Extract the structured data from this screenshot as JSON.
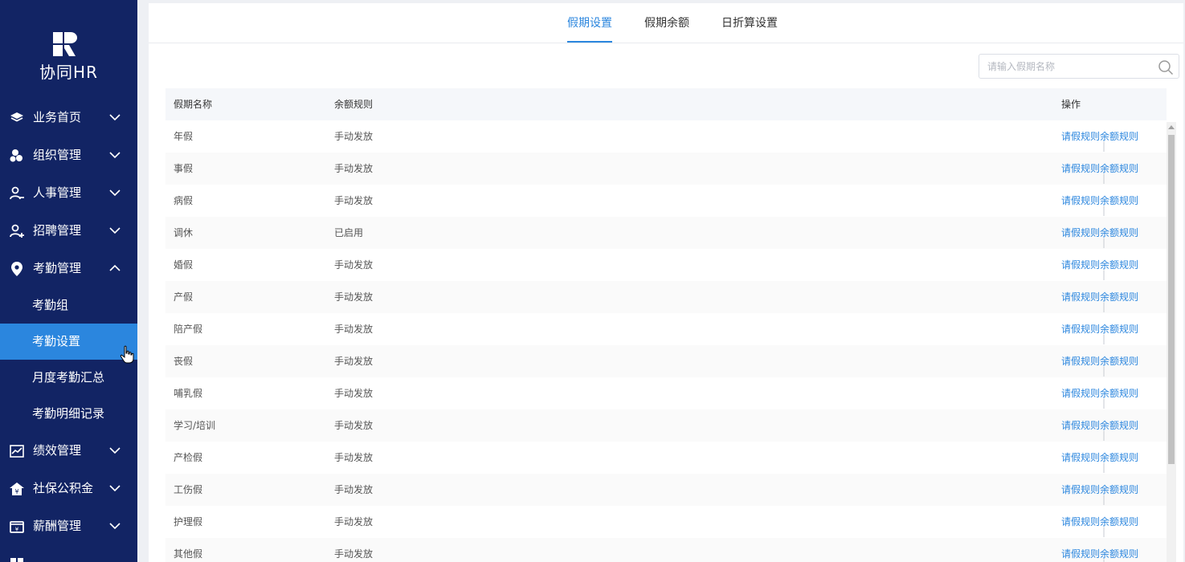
{
  "brand": {
    "name": "协同HR"
  },
  "sidebar": {
    "items": [
      {
        "label": "业务首页",
        "icon": "layers-icon",
        "expanded": false
      },
      {
        "label": "组织管理",
        "icon": "org-icon",
        "expanded": false
      },
      {
        "label": "人事管理",
        "icon": "user-minus-icon",
        "expanded": false
      },
      {
        "label": "招聘管理",
        "icon": "user-plus-icon",
        "expanded": false
      },
      {
        "label": "考勤管理",
        "icon": "location-pin-icon",
        "expanded": true,
        "children": [
          {
            "label": "考勤组"
          },
          {
            "label": "考勤设置",
            "active": true
          },
          {
            "label": "月度考勤汇总"
          },
          {
            "label": "考勤明细记录"
          }
        ]
      },
      {
        "label": "绩效管理",
        "icon": "trend-chart-icon",
        "expanded": false
      },
      {
        "label": "社保公积金",
        "icon": "house-yen-icon",
        "expanded": false
      },
      {
        "label": "薪酬管理",
        "icon": "wallet-yen-icon",
        "expanded": false
      }
    ]
  },
  "tabs": [
    {
      "label": "假期设置",
      "active": true
    },
    {
      "label": "假期余额",
      "active": false
    },
    {
      "label": "日折算设置",
      "active": false
    }
  ],
  "search": {
    "placeholder": "请输入假期名称"
  },
  "table": {
    "headers": [
      "假期名称",
      "余额规则",
      "操作"
    ],
    "rows": [
      {
        "name": "年假",
        "rule": "手动发放"
      },
      {
        "name": "事假",
        "rule": "手动发放"
      },
      {
        "name": "病假",
        "rule": "手动发放"
      },
      {
        "name": "调休",
        "rule": "已启用"
      },
      {
        "name": "婚假",
        "rule": "手动发放"
      },
      {
        "name": "产假",
        "rule": "手动发放"
      },
      {
        "name": "陪产假",
        "rule": "手动发放"
      },
      {
        "name": "丧假",
        "rule": "手动发放"
      },
      {
        "name": "哺乳假",
        "rule": "手动发放"
      },
      {
        "name": "学习/培训",
        "rule": "手动发放"
      },
      {
        "name": "产检假",
        "rule": "手动发放"
      },
      {
        "name": "工伤假",
        "rule": "手动发放"
      },
      {
        "name": "护理假",
        "rule": "手动发放"
      },
      {
        "name": "其他假",
        "rule": "手动发放"
      }
    ],
    "actions": {
      "leave_rule": "请假规则",
      "balance_rule": "余额规则"
    }
  },
  "colors": {
    "sidebar_bg": "#122464",
    "accent": "#2b86de"
  }
}
